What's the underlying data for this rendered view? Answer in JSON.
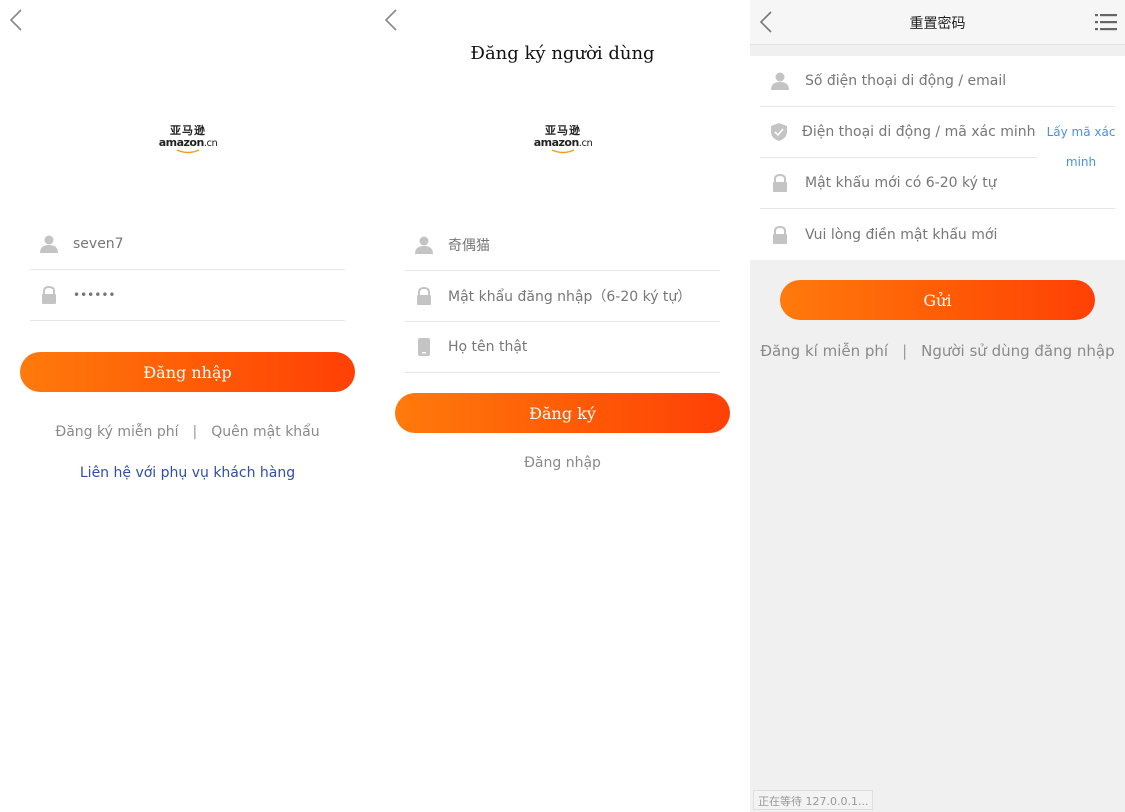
{
  "login": {
    "username_value": "seven7",
    "password_value": "••••••",
    "login_button": "Đăng nhập",
    "register_link": "Đăng ký miễn phí",
    "separator": "|",
    "forgot_link": "Quên mật khẩu",
    "contact_link": "Liên hệ với phụ vụ khách hàng"
  },
  "logo": {
    "cn": "亚马逊",
    "en": "amazon",
    "suffix": ".cn"
  },
  "register": {
    "title": "Đăng ký người dùng",
    "username_value": "奇偶猫",
    "password_placeholder": "Mật khẩu đăng nhập（6-20 ký tự）",
    "realname_placeholder": "Họ tên thật",
    "register_button": "Đăng ký",
    "login_link": "Đăng nhập"
  },
  "reset": {
    "title": "重置密码",
    "phone_email_placeholder": "Số điện thoại di động / email",
    "code_placeholder": "Điện thoại di động / mã xác minh email",
    "get_code": "Lấy mã xác minh",
    "new_password_placeholder": "Mật khẩu mới có 6-20 ký tự",
    "confirm_password_placeholder": "Vui lòng điền mật khẩu mới",
    "submit_button": "Gửi",
    "register_link": "Đăng kí miễn phí",
    "separator": "|",
    "login_link": "Người sử dùng đăng nhập",
    "status_text": "正在等待 127.0.0.1..."
  },
  "colors": {
    "accent_start": "#ff7a0c",
    "accent_end": "#ff4006",
    "link_blue": "#2f4fa8",
    "code_blue": "#4a90e2",
    "icon_gray": "#c4c4c4"
  },
  "icons": [
    "back-arrow-icon",
    "user-icon",
    "lock-icon",
    "phone-icon",
    "shield-check-icon",
    "menu-list-icon"
  ]
}
